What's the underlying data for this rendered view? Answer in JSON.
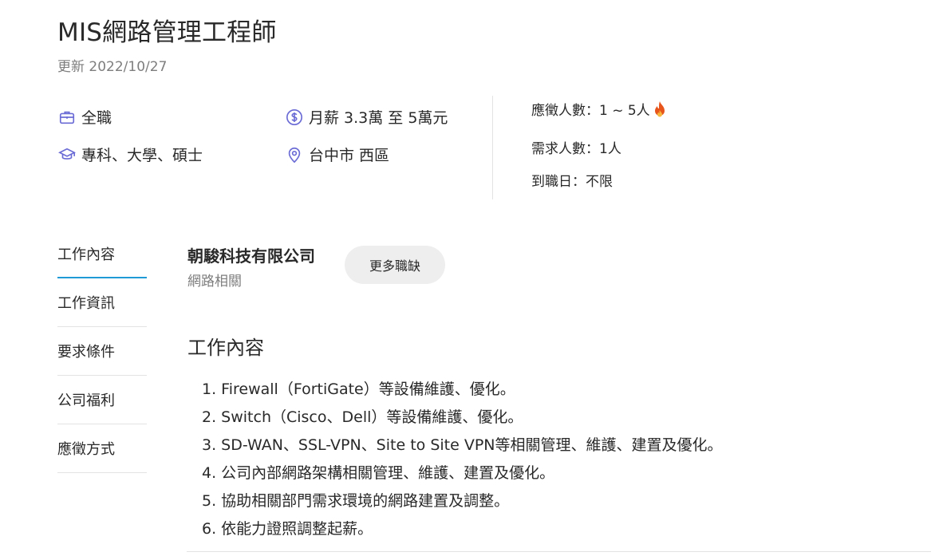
{
  "job": {
    "title": "MIS網路管理工程師",
    "updated": "更新 2022/10/27"
  },
  "info": {
    "job_type": {
      "icon": "briefcase-icon",
      "text": "全職"
    },
    "education": {
      "icon": "graduation-cap-icon",
      "text": "專科、大學、碩士"
    },
    "salary": {
      "icon": "dollar-icon",
      "text": "月薪 3.3萬 至 5萬元"
    },
    "location": {
      "icon": "location-pin-icon",
      "text": "台中市 西區"
    }
  },
  "stats": {
    "applicants": "應徵人數：1 ~ 5人",
    "applicants_icon": "fire-icon",
    "headcount": "需求人數：1人",
    "start_date": "到職日：不限"
  },
  "nav": {
    "items": [
      {
        "label": "工作內容"
      },
      {
        "label": "工作資訊"
      },
      {
        "label": "要求條件"
      },
      {
        "label": "公司福利"
      },
      {
        "label": "應徵方式"
      }
    ]
  },
  "company": {
    "name": "朝駿科技有限公司",
    "industry": "網路相關",
    "more_jobs_label": "更多職缺"
  },
  "content": {
    "section_title": "工作內容",
    "lines": [
      "1. Firewall（FortiGate）等設備維護、優化。",
      "2. Switch（Cisco、Dell）等設備維護、優化。",
      "3. SD-WAN、SSL-VPN、Site to Site VPN等相關管理、維護、建置及優化。",
      "4. 公司內部網路架構相關管理、維護、建置及優化。",
      "5. 協助相關部門需求環境的網路建置及調整。",
      "6. 依能力證照調整起薪。"
    ]
  },
  "colors": {
    "icon_purple": "#6b6bd6",
    "active_tab": "#1f9ad6",
    "fire": "#e8551c"
  }
}
